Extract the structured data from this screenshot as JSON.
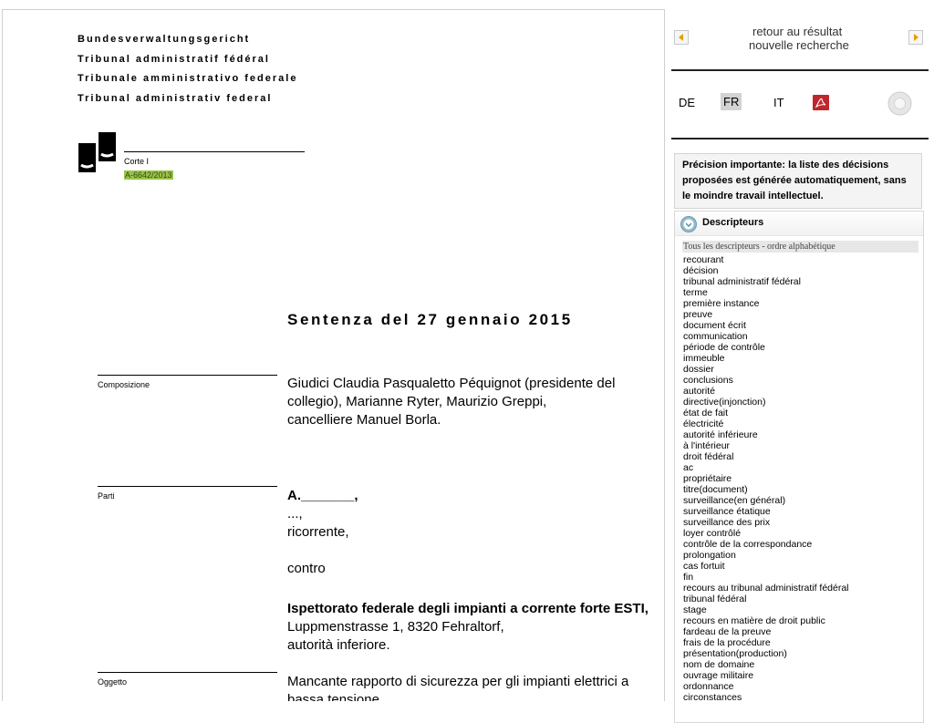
{
  "document": {
    "court_names": [
      "Bundesverwaltungsgericht",
      "Tribunal administratif fédéral",
      "Tribunale amministrativo federale",
      "Tribunal administrativ federal"
    ],
    "division": "Corte I",
    "reference": "A-6642/2013",
    "title": "Sentenza del 27 gennaio 2015",
    "sections": {
      "composition": {
        "label": "Composizione",
        "lines": [
          "Giudici Claudia Pasqualetto Péquignot (presidente del",
          "collegio), Marianne Ryter, Maurizio Greppi,",
          "cancelliere Manuel Borla."
        ]
      },
      "parties": {
        "label": "Parti",
        "appellant": "A._______,",
        "appellant_address": "...,",
        "appellant_role": "ricorrente,",
        "versus": "contro",
        "respondent": "Ispettorato federale degli impianti a corrente forte ESTI,",
        "respondent_address": "Luppmenstrasse 1, 8320 Fehraltorf,",
        "respondent_role": "autorità inferiore."
      },
      "subject": {
        "label": "Oggetto",
        "lines": [
          "Mancante rapporto di sicurezza per gli impianti elettrici a",
          "bassa tensione."
        ]
      }
    }
  },
  "panel": {
    "back_link": "retour au résultat",
    "new_search_link": "nouvelle recherche",
    "languages": [
      "DE",
      "FR",
      "IT"
    ],
    "active_language": "FR",
    "notice": "Précision importante: la liste des décisions proposées est générée automatiquement, sans le moindre travail intellectuel.",
    "descriptors": {
      "heading": "Descripteurs",
      "subheading": "Tous les descripteurs - ordre alphabétique",
      "items": [
        "recourant",
        "décision",
        "tribunal administratif fédéral",
        "terme",
        "première instance",
        "preuve",
        "document écrit",
        "communication",
        "période de contrôle",
        "immeuble",
        "dossier",
        "conclusions",
        "autorité",
        "directive(injonction)",
        "état de fait",
        "électricité",
        "autorité inférieure",
        "à l'intérieur",
        "droit fédéral",
        "ac",
        "propriétaire",
        "titre(document)",
        "surveillance(en général)",
        "surveillance étatique",
        "surveillance des prix",
        "loyer contrôlé",
        "contrôle de la correspondance",
        "prolongation",
        "cas fortuit",
        "fin",
        "recours au tribunal administratif fédéral",
        "tribunal fédéral",
        "stage",
        "recours en matière de droit public",
        "fardeau de la preuve",
        "frais de la procédure",
        "présentation(production)",
        "nom de domaine",
        "ouvrage militaire",
        "ordonnance",
        "circonstances"
      ]
    },
    "colors": {
      "accent_highlight": "#9cc24a",
      "pdf_red": "#c0272d",
      "active_lang_bg": "#d3d3d3"
    }
  }
}
